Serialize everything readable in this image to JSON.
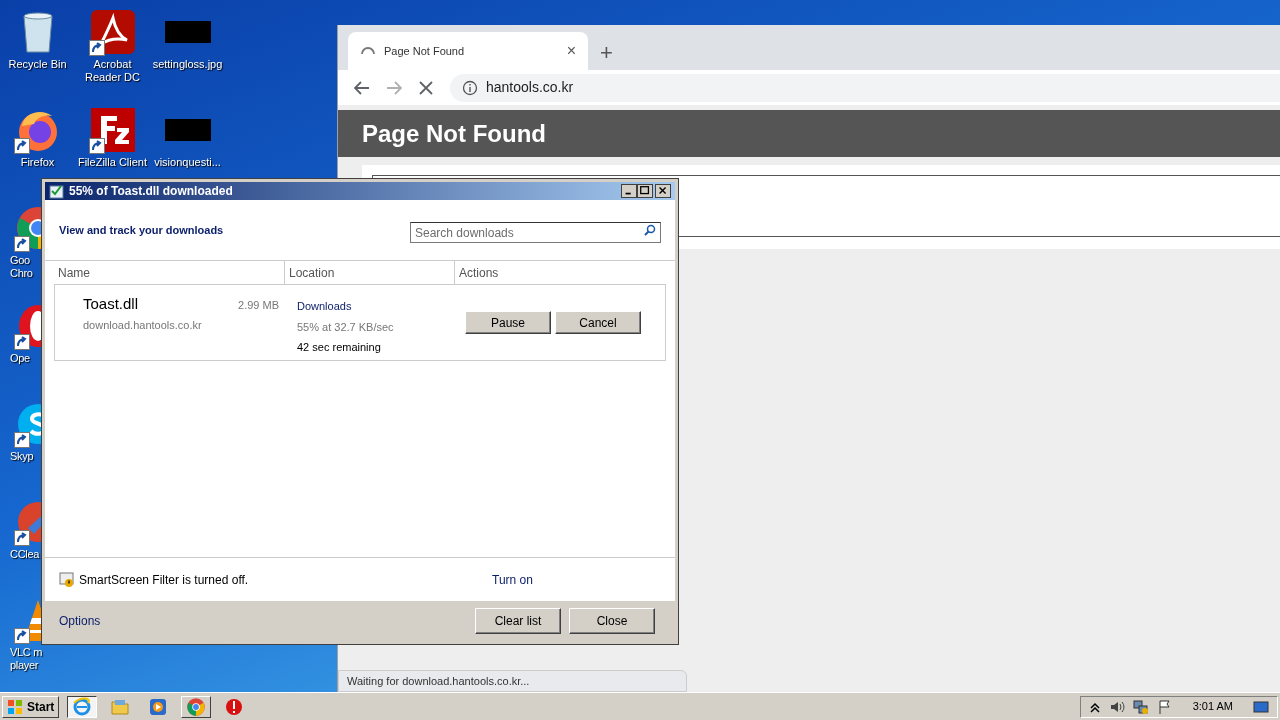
{
  "desktop": {
    "columns": [
      [
        {
          "kind": "recycle",
          "label": [
            "Recycle Bin"
          ],
          "shortcut": false,
          "cut": false
        },
        {
          "kind": "firefox",
          "label": [
            "Firefox"
          ],
          "shortcut": true,
          "cut": false
        },
        {
          "kind": "chrome",
          "label": [
            "Goo",
            "Chro"
          ],
          "shortcut": true,
          "cut": true
        },
        {
          "kind": "opera",
          "label": [
            "Ope"
          ],
          "shortcut": true,
          "cut": true
        },
        {
          "kind": "skype",
          "label": [
            "Skyp"
          ],
          "shortcut": true,
          "cut": true
        },
        {
          "kind": "ccleaner",
          "label": [
            "CClea"
          ],
          "shortcut": true,
          "cut": true
        },
        {
          "kind": "vlc",
          "label": [
            "VLC m",
            "player"
          ],
          "shortcut": true,
          "cut": true
        }
      ],
      [
        {
          "kind": "acrobat",
          "label": [
            "Acrobat",
            "Reader DC"
          ],
          "shortcut": true,
          "cut": false
        },
        {
          "kind": "filezilla",
          "label": [
            "FileZilla Client"
          ],
          "shortcut": true,
          "cut": false
        }
      ],
      [
        {
          "kind": "redacted",
          "label": [
            "settingloss.jpg"
          ],
          "shortcut": false,
          "cut": false
        },
        {
          "kind": "redacted",
          "label": [
            "visionquesti..."
          ],
          "shortcut": false,
          "cut": false
        }
      ]
    ]
  },
  "browser": {
    "tab": {
      "title": "Page Not Found",
      "close": "×",
      "loading": true
    },
    "new_tab": "+",
    "nav": [
      {
        "kind": "back",
        "disabled": false
      },
      {
        "kind": "forward",
        "disabled": true
      },
      {
        "kind": "stop",
        "disabled": false
      }
    ],
    "address": "hantools.co.kr",
    "page_heading": "Page Not Found",
    "status": "Waiting for download.hantools.co.kr..."
  },
  "dialog": {
    "title": "55% of Toast.dll downloaded",
    "heading": "View and track your downloads",
    "search": {
      "placeholder": "Search downloads"
    },
    "columns": [
      "Name",
      "Location",
      "Actions"
    ],
    "downloads": [
      {
        "name": "Toast.dll",
        "size": "2.99 MB",
        "source": "download.hantools.co.kr",
        "location": "Downloads",
        "progress": "55% at 32.7 KB/sec",
        "remaining": "42 sec remaining",
        "actions": [
          "Pause",
          "Cancel"
        ]
      }
    ],
    "smartscreen": {
      "text": "SmartScreen Filter is turned off.",
      "link": "Turn on"
    },
    "options": "Options",
    "buttons": [
      "Clear list",
      "Close"
    ]
  },
  "taskbar": {
    "start": "Start",
    "items": [
      {
        "kind": "ie",
        "selected": true,
        "open": true
      },
      {
        "kind": "explorer",
        "selected": false,
        "open": false
      },
      {
        "kind": "media",
        "selected": false,
        "open": false
      },
      {
        "kind": "chrome",
        "selected": false,
        "open": true
      },
      {
        "kind": "stop",
        "selected": false,
        "open": false
      }
    ],
    "tray": [
      {
        "kind": "chevron"
      },
      {
        "kind": "volume"
      },
      {
        "kind": "network"
      },
      {
        "kind": "flag"
      }
    ],
    "time": "3:01 AM"
  }
}
